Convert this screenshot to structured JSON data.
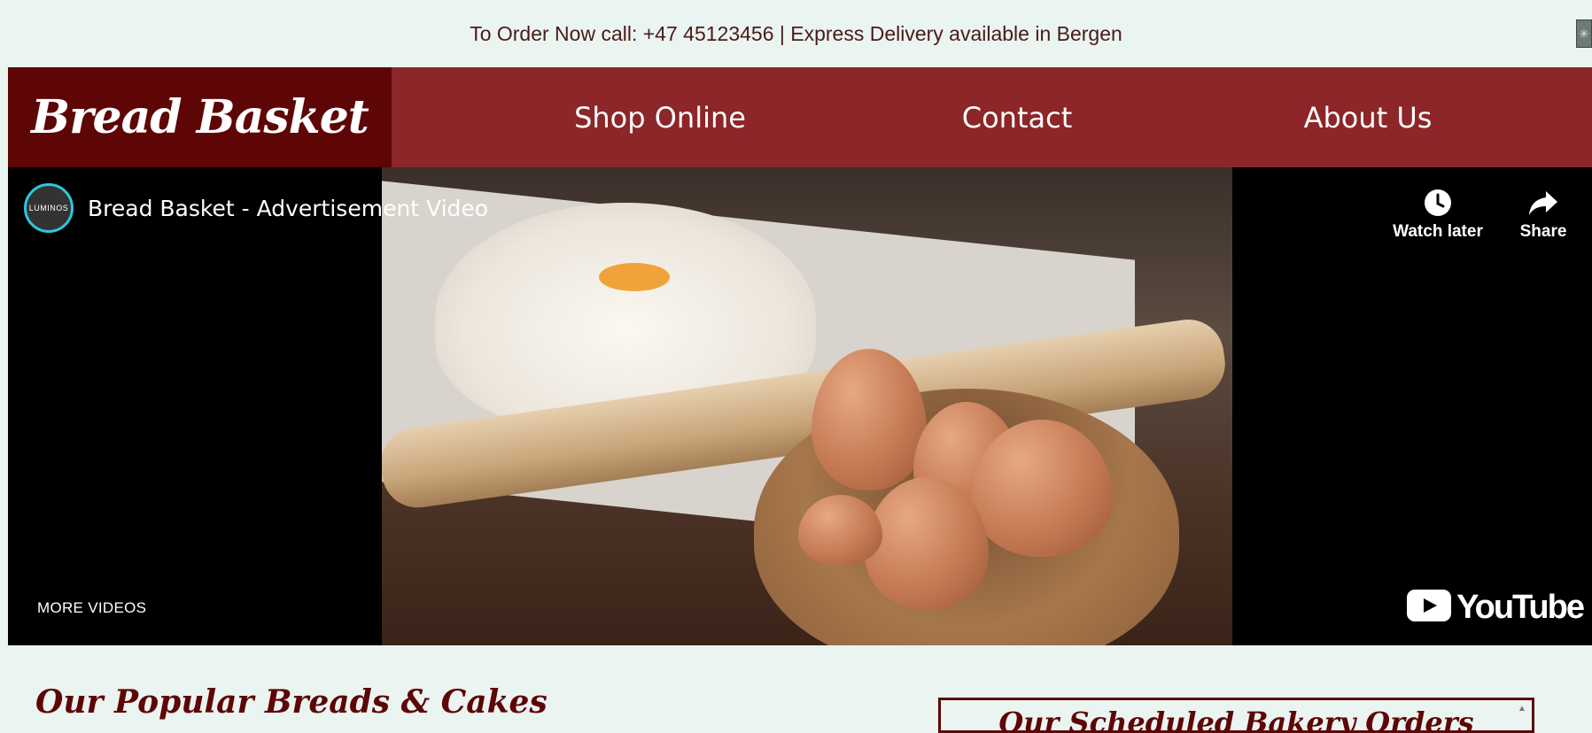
{
  "topbar": {
    "announcement": "To Order Now call: +47 45123456 | Express Delivery available in Bergen",
    "corner_icon": "sparkle-icon"
  },
  "navbar": {
    "brand": "Bread Basket",
    "items": [
      {
        "label": "Shop Online"
      },
      {
        "label": "Contact"
      },
      {
        "label": "About Us"
      }
    ],
    "colors": {
      "bar": "#8c2629",
      "brand_bg": "#5e0505"
    }
  },
  "video": {
    "channel_avatar_text": "LUMINOS",
    "title": "Bread Basket - Advertisement Video",
    "watch_later_label": "Watch later",
    "share_label": "Share",
    "more_videos_label": "MORE VIDEOS",
    "logo_text": "YouTube",
    "icons": [
      "clock-icon",
      "share-arrow-icon",
      "youtube-play-icon"
    ]
  },
  "main": {
    "section_heading": "Our Popular Breads & Cakes",
    "side_box_title": "Our Scheduled Bakery Orders"
  }
}
